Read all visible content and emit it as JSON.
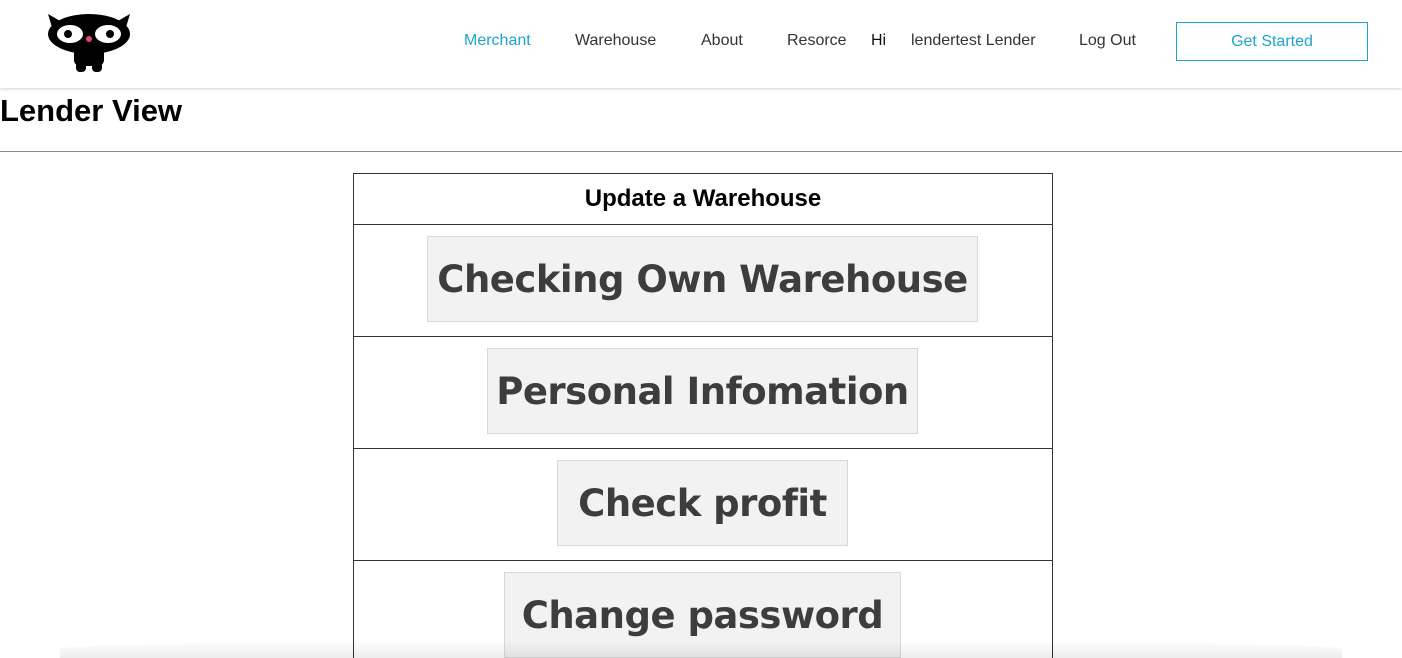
{
  "brand": {
    "logo_icon": "black-cat-logo-icon"
  },
  "nav": {
    "merchant": "Merchant",
    "warehouse": "Warehouse",
    "about": "About",
    "resource": "Resorce",
    "greeting": "Hi",
    "user_name": "lendertest Lender",
    "logout": "Log Out",
    "get_started": "Get Started"
  },
  "colors": {
    "accent": "#1ba4d4",
    "button_bg": "#f2f2f2",
    "button_text": "#3d3d3d"
  },
  "page": {
    "title": "Lender View"
  },
  "panel": {
    "header": "Update a Warehouse",
    "buttons": [
      "Checking Own Warehouse",
      "Personal Infomation",
      "Check profit",
      "Change password"
    ]
  }
}
